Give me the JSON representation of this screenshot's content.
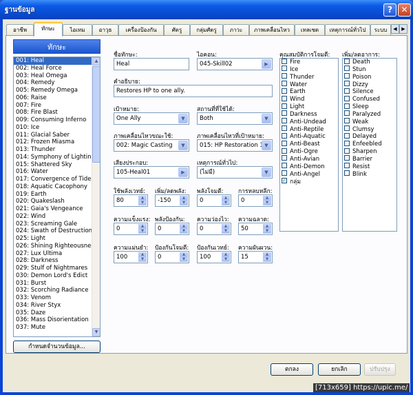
{
  "window": {
    "title": "ฐานข้อมูล",
    "help_label": "?",
    "close_label": "✕"
  },
  "tabs": [
    {
      "label": "อาชีพ"
    },
    {
      "label": "ทักษะ"
    },
    {
      "label": "ไอเทม"
    },
    {
      "label": "อาวุธ"
    },
    {
      "label": "เครื่องป้องกัน"
    },
    {
      "label": "ศัตรู"
    },
    {
      "label": "กลุ่มศัตรู"
    },
    {
      "label": "ภาวะ"
    },
    {
      "label": "ภาพเคลื่อนไหว"
    },
    {
      "label": "เทลเซต"
    },
    {
      "label": "เหตุการณ์ทั่วไป"
    },
    {
      "label": "ระบบ"
    }
  ],
  "list": {
    "header": "ทักษะ",
    "selected_index": 0,
    "items": [
      "001: Heal",
      "002: Heal Force",
      "003: Heal Omega",
      "004: Remedy",
      "005: Remedy Omega",
      "006: Raise",
      "007: Fire",
      "008: Fire Blast",
      "009: Consuming Inferno",
      "010: Ice",
      "011: Glacial Saber",
      "012: Frozen Miasma",
      "013: Thunder",
      "014: Symphony of Lighting",
      "015: Shattered Sky",
      "016: Water",
      "017: Convergence of Tides",
      "018: Aquatic Cacophony",
      "019: Earth",
      "020: Quakeslash",
      "021: Gaia's Vengeance",
      "022: Wind",
      "023: Screaming Gale",
      "024: Swath of Destruction",
      "025: Light",
      "026: Shining Righteousness",
      "027: Lux Ultima",
      "028: Darkness",
      "029: Stulf of Nightmares",
      "030: Demon Lord's Edict",
      "031: Burst",
      "032: Scorching Radiance",
      "033: Venom",
      "034: River Styx",
      "035: Daze",
      "036: Mass Disorientation",
      "037: Mute"
    ],
    "change_max_label": "กำหนดจำนวนข้อมูล..."
  },
  "form": {
    "name_label": "ชื่อทักษะ:",
    "name_value": "Heal",
    "icon_label": "ไอคอน:",
    "icon_value": "045-Skill02",
    "desc_label": "คำอธิบาย:",
    "desc_value": "Restores HP to one ally.",
    "scope_label": "เป้าหมาย:",
    "scope_value": "One Ally",
    "occasion_label": "สถานที่ที่ใช้ได้:",
    "occasion_value": "Both",
    "user_anim_label": "ภาพเคลื่อนไหวขณะใช้:",
    "user_anim_value": "002: Magic Casting",
    "target_anim_label": "ภาพเคลื่อนไหวที่เป้าหมาย:",
    "target_anim_value": "015: HP Restoration 1",
    "menu_se_label": "เสียงประกอบ:",
    "menu_se_value": "105-Heal01",
    "common_event_label": "เหตุการณ์ทั่วไป:",
    "common_event_value": "(ไม่มี)",
    "params": [
      {
        "label": "ใช้พลังเวทย์:",
        "value": "80"
      },
      {
        "label": "เพิ่ม/ลดพลัง:",
        "value": "-150"
      },
      {
        "label": "พลังโจมตี:",
        "value": "0"
      },
      {
        "label": "การหลบหลีก:",
        "value": "0"
      },
      {
        "label": "ความแข็งแรง:",
        "value": "0"
      },
      {
        "label": "พลังป้องกัน:",
        "value": "0"
      },
      {
        "label": "ความว่องไว:",
        "value": "0"
      },
      {
        "label": "ความฉลาด:",
        "value": "50"
      },
      {
        "label": "ความแม่นยำ:",
        "value": "100"
      },
      {
        "label": "ป้องกันโจมตี:",
        "value": "0"
      },
      {
        "label": "ป้องกันเวทย์:",
        "value": "100"
      },
      {
        "label": "ความผันผวน:",
        "value": "15"
      }
    ]
  },
  "elements": {
    "label": "คุณสมบัติการโจมตี:",
    "items": [
      {
        "label": "Fire",
        "checked": false
      },
      {
        "label": "Ice",
        "checked": false
      },
      {
        "label": "Thunder",
        "checked": false
      },
      {
        "label": "Water",
        "checked": false
      },
      {
        "label": "Earth",
        "checked": false
      },
      {
        "label": "Wind",
        "checked": false
      },
      {
        "label": "Light",
        "checked": false
      },
      {
        "label": "Darkness",
        "checked": false
      },
      {
        "label": "Anti-Undead",
        "checked": false
      },
      {
        "label": "Anti-Reptile",
        "checked": false
      },
      {
        "label": "Anti-Aquatic",
        "checked": false
      },
      {
        "label": "Anti-Beast",
        "checked": false
      },
      {
        "label": "Anti-Ogre",
        "checked": false
      },
      {
        "label": "Anti-Avian",
        "checked": false
      },
      {
        "label": "Anti-Demon",
        "checked": false
      },
      {
        "label": "Anti-Angel",
        "checked": false
      },
      {
        "label": "กลุ่ม",
        "checked": true
      }
    ]
  },
  "states": {
    "label": "เพิ่ม/ลดอาการ:",
    "items": [
      {
        "label": "Death"
      },
      {
        "label": "Stun"
      },
      {
        "label": "Poison"
      },
      {
        "label": "Dizzy"
      },
      {
        "label": "Silence"
      },
      {
        "label": "Confused"
      },
      {
        "label": "Sleep"
      },
      {
        "label": "Paralyzed"
      },
      {
        "label": "Weak"
      },
      {
        "label": "Clumsy"
      },
      {
        "label": "Delayed"
      },
      {
        "label": "Enfeebled"
      },
      {
        "label": "Sharpen"
      },
      {
        "label": "Barrier"
      },
      {
        "label": "Resist"
      },
      {
        "label": "Blink"
      }
    ]
  },
  "footer": {
    "ok": "ตกลง",
    "cancel": "ยกเลิก",
    "apply": "ปรับปรุง",
    "watermark": "[713x659] https://upic.me/"
  },
  "colors": {
    "titlebar": "#0b5ae6",
    "selection": "#316ac5",
    "tab_highlight": "#ffc83c",
    "dialog_bg": "#ece9d8"
  }
}
